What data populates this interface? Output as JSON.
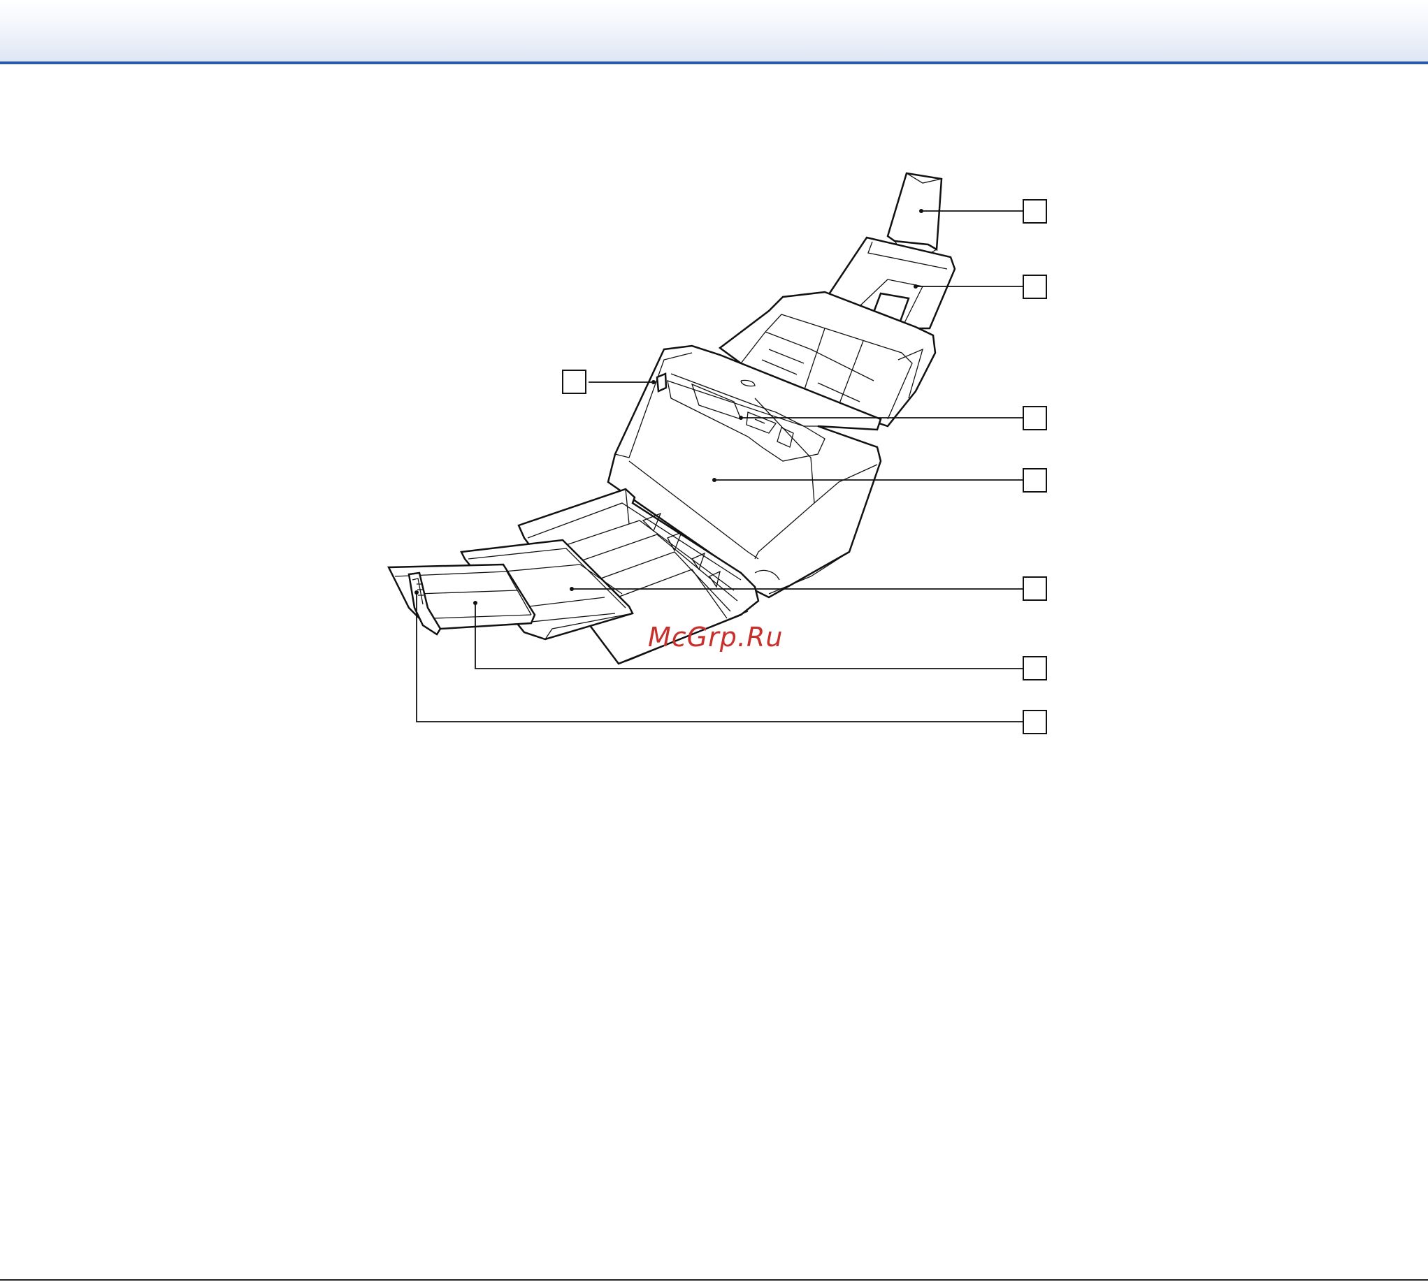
{
  "watermark": {
    "text": "McGrp.Ru",
    "color": "#c8302c"
  },
  "header": {
    "rule_color": "#2a5aa8"
  },
  "callouts": [
    {
      "id": "callout-1"
    },
    {
      "id": "callout-2"
    },
    {
      "id": "callout-3"
    },
    {
      "id": "callout-4"
    },
    {
      "id": "callout-5"
    },
    {
      "id": "callout-6"
    },
    {
      "id": "callout-7"
    },
    {
      "id": "callout-8"
    }
  ]
}
